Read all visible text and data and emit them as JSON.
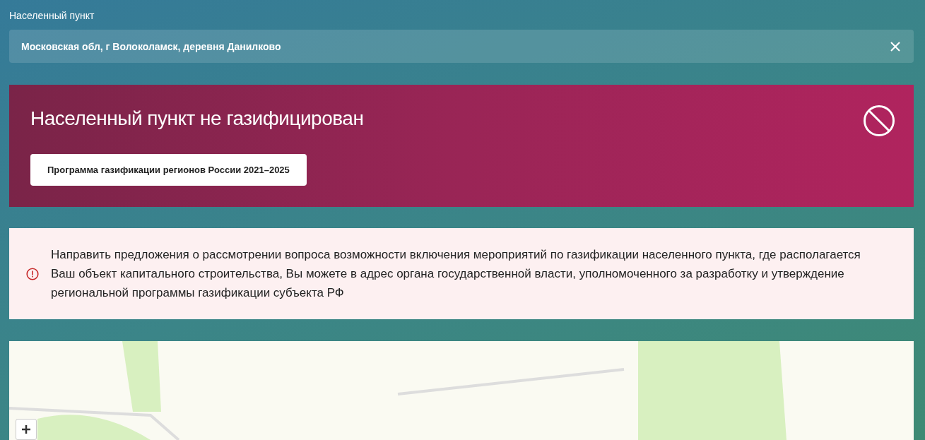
{
  "location_field": {
    "label": "Населенный пункт",
    "value": "Московская обл, г Волоколамск, деревня Данилково"
  },
  "status_banner": {
    "title": "Населенный пункт не газифицирован",
    "button": "Программа газификации регионов России 2021–2025"
  },
  "notice": {
    "text": "Направить предложения о рассмотрении вопроса возможности включения мероприятий по газификации населенного пункта, где располагается Ваш объект капитального строительства, Вы можете в адрес органа государственной власти, уполномоченного за разработку и утверждение региональной программы газификации субъекта РФ"
  }
}
